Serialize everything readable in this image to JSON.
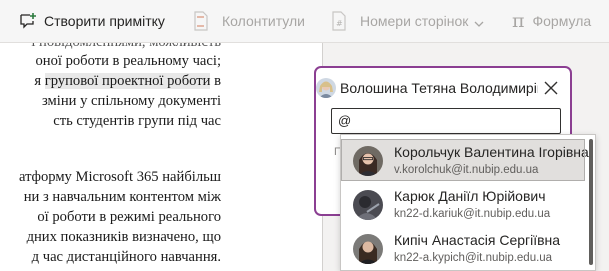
{
  "toolbar": {
    "new_comment": "Створити примітку",
    "headers_footers": "Колонтитули",
    "page_numbers": "Номери сторінок",
    "formula": "Формула",
    "formula_symbol": "π"
  },
  "document": {
    "line_cut": "і повідомленнями, можливість",
    "line1": "оної роботи в реальному часі;",
    "line2_pre": "я ",
    "line2_hl": "групової проектної роботи",
    "line2_post": " в",
    "line3": "зміни у спільному документі",
    "line4": "сть студентів групи під час",
    "line5": "атформу Microsoft 365 найбільш",
    "line6": "ни з навчальним контентом між",
    "line7": "ої роботи в режимі реального",
    "line8": "дних показників визначено, що",
    "line9": "д час дистанційного навчання."
  },
  "comment": {
    "author": "Волошина Тетяна Володимирівна",
    "input_value": "@",
    "hint": "П"
  },
  "suggestions": [
    {
      "name": "Корольчук Валентина Ігорівна",
      "email": "v.korolchuk@it.nubip.edu.ua"
    },
    {
      "name": "Карюк Данiїл Юрійович",
      "email": "kn22-d.kariuk@it.nubip.edu.ua"
    },
    {
      "name": "Кипіч Анастасія Сергіївна",
      "email": "kn22-a.kypich@it.nubip.edu.ua"
    }
  ],
  "colors": {
    "accent": "#8b3f92",
    "toolbar_bg": "#f6f6f6",
    "disabled_text": "#a8a6a4"
  }
}
